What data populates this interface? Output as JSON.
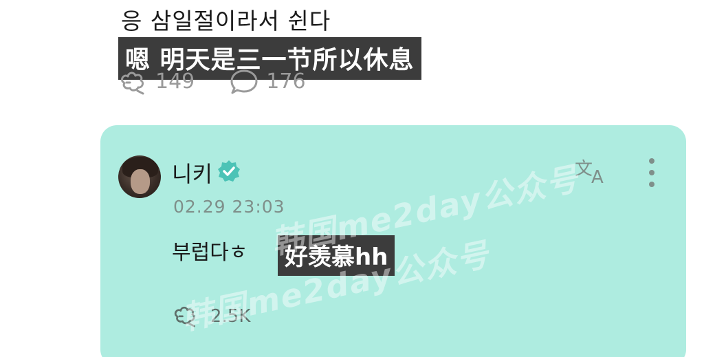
{
  "post": {
    "text": "응 삼일절이라서 쉰다",
    "subtitle": "嗯 明天是三一节所以休息",
    "likes": "149",
    "comments": "176"
  },
  "reply": {
    "username": "니키",
    "timestamp": "02.29 23:03",
    "message": "부럽다ㅎ",
    "message_subtitle": "好羡慕hh",
    "likes": "2.5K",
    "background_color": "#aeece0"
  },
  "watermark": {
    "line1": "韩国me2day公众号",
    "line2": "韩国me2day公众号"
  },
  "icons": {
    "like": "like-icon",
    "comment": "comment-icon",
    "verified": "verified-badge-icon",
    "translate": "translate-icon",
    "more": "more-vertical-icon"
  }
}
